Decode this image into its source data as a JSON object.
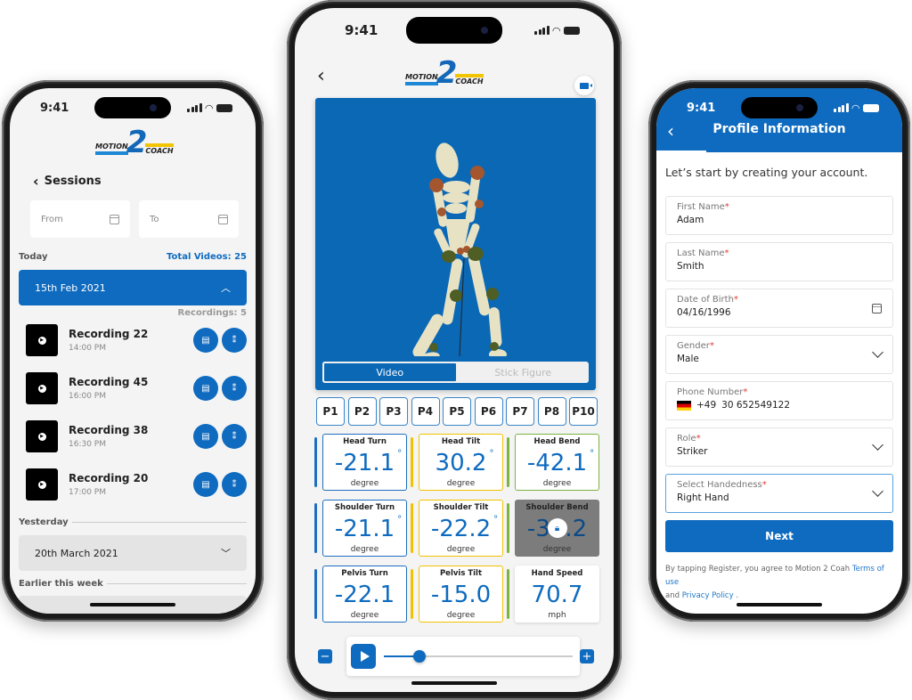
{
  "status_time": "9:41",
  "logo": {
    "top": "MOTION",
    "number": "2",
    "bottom": "COACH"
  },
  "sessions_screen": {
    "title": "Sessions",
    "from_placeholder": "From",
    "to_placeholder": "To",
    "today_label": "Today",
    "total_videos": "Total Videos: 25",
    "open_group": "15th Feb 2021",
    "recordings_count": "Recordings: 5",
    "recordings": [
      {
        "name": "Recording 22",
        "time": "14:00 PM"
      },
      {
        "name": "Recording 45",
        "time": "16:00 PM"
      },
      {
        "name": "Recording 38",
        "time": "16:30 PM"
      },
      {
        "name": "Recording 20",
        "time": "17:00 PM"
      }
    ],
    "yesterday_label": "Yesterday",
    "yesterday_group": "20th March 2021",
    "earlier_label": "Earlier this week"
  },
  "analysis_screen": {
    "view_toggle": [
      "Video",
      "Stick Figure"
    ],
    "active_view": "Video",
    "positions": [
      "P1",
      "P2",
      "P3",
      "P4",
      "P5",
      "P6",
      "P7",
      "P8",
      "P10"
    ],
    "metrics": [
      {
        "label": "Head Turn",
        "value": "-21.1",
        "unit": "degree",
        "deg": true,
        "color": "#1f6fbf"
      },
      {
        "label": "Head Tilt",
        "value": "30.2",
        "unit": "degree",
        "deg": true,
        "color": "#f2c200"
      },
      {
        "label": "Head Bend",
        "value": "-42.1",
        "unit": "degree",
        "deg": true,
        "color": "#7cb342"
      },
      {
        "label": "Shoulder Turn",
        "value": "-21.1",
        "unit": "degree",
        "deg": true,
        "color": "#1f6fbf"
      },
      {
        "label": "Shoulder Tilt",
        "value": "-22.2",
        "unit": "degree",
        "deg": true,
        "color": "#f2c200"
      },
      {
        "label": "Shoulder Bend",
        "value": "-32.2",
        "unit": "degree",
        "deg": false,
        "color": "#7cb342",
        "locked": true
      },
      {
        "label": "Pelvis Turn",
        "value": "-22.1",
        "unit": "degree",
        "deg": false,
        "color": "#1f6fbf"
      },
      {
        "label": "Pelvis Tilt",
        "value": "-15.0",
        "unit": "degree",
        "deg": false,
        "color": "#f2c200"
      },
      {
        "label": "Hand Speed",
        "value": "70.7",
        "unit": "mph",
        "deg": false,
        "color": "#7cb342"
      }
    ],
    "playback_progress": 0.19,
    "minus_label": "−",
    "plus_label": "+"
  },
  "profile_screen": {
    "title": "Profile Information",
    "intro": "Let’s start by creating your account.",
    "fields": [
      {
        "label": "First Name",
        "value": "Adam",
        "kind": "text"
      },
      {
        "label": "Last Name",
        "value": "Smith",
        "kind": "text"
      },
      {
        "label": "Date of Birth",
        "value": "04/16/1996",
        "kind": "date"
      },
      {
        "label": "Gender",
        "value": "Male",
        "kind": "select"
      },
      {
        "label": "Phone Number",
        "value": "30 652549122",
        "country_code": "+49",
        "kind": "phone"
      },
      {
        "label": "Role",
        "value": "Striker",
        "kind": "select"
      },
      {
        "label": "Select Handedness",
        "value": "Right Hand",
        "kind": "select",
        "focused": true
      }
    ],
    "required_mark": "*",
    "next_label": "Next",
    "terms_prefix": "By tapping Register, you agree to Motion 2 Coah",
    "terms_link": "Terms of use",
    "terms_and": "and",
    "privacy_link": "Privacy Policy",
    "terms_suffix": "."
  },
  "colors": {
    "brand_blue": "#0f6bbf",
    "required_red": "#e53935"
  }
}
